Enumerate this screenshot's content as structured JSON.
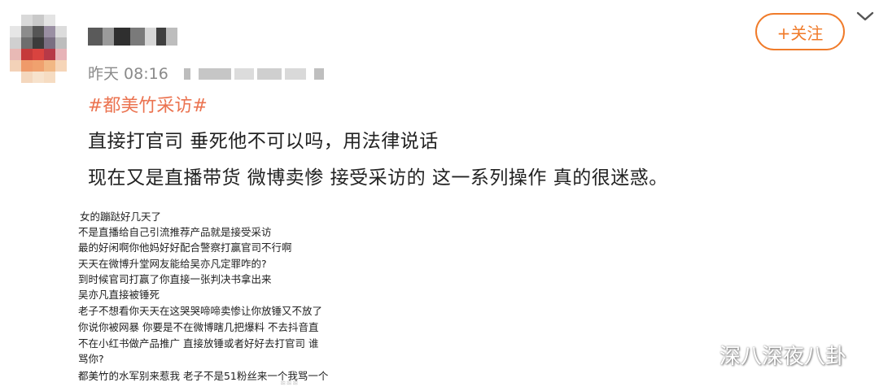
{
  "post": {
    "time": "昨天 08:16",
    "topic": "#都美竹采访#",
    "lines": [
      "直接打官司 垂死他不可以吗，用法律说话",
      "现在又是直播带货 微博卖惨 接受采访的 这一系列操作 真的很迷惑。"
    ]
  },
  "header": {
    "follow_label": "+关注",
    "menu_icon": "chevron-down-icon"
  },
  "screenshot": {
    "comments": [
      "女的蹦跶好几天了",
      "不是直播给自己引流推荐产品就是接受采访",
      "最的好闲啊你他妈好好配合警察打赢官司不行啊",
      "天天在微博升堂网友能给吴亦凡定罪咋的?",
      "到时候官司打赢了你直接一张判决书拿出来",
      "吴亦凡直接被锤死",
      "老子不想看你天天在这哭哭啼啼卖惨让你放锤又不放了",
      "你说你被网暴 你要是不在微博瞎几把爆料 不去抖音直",
      "不在小红书做产品推广 直接放锤或者好好去打官司 谁",
      "骂你?",
      "都美竹的水军别来惹我 老子不是51粉丝来一个我骂一个"
    ]
  },
  "watermark": {
    "text": "深八深夜八卦",
    "icon": "wechat-icon"
  },
  "colors": {
    "accent": "#f07b2a",
    "topic": "#eb7350",
    "meta": "#8a8a8a",
    "text": "#222222"
  }
}
